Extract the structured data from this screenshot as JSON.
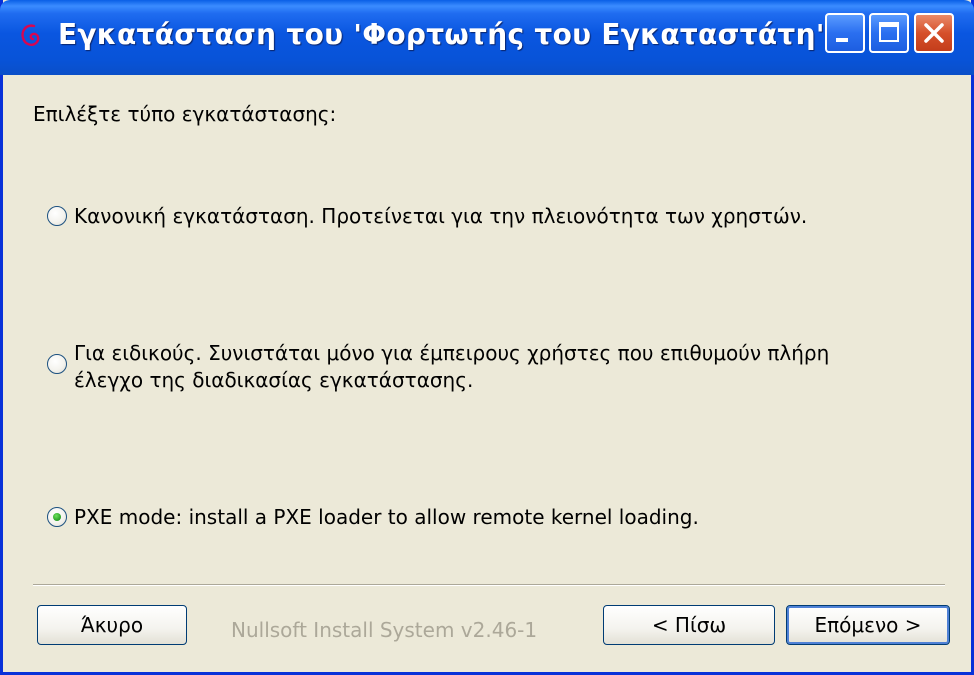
{
  "window": {
    "title": "Εγκατάσταση του 'Φορτωτής του Εγκαταστάτη'",
    "controls": [
      "minimize-icon",
      "maximize-icon",
      "close-icon"
    ],
    "accent_color": "#0a56e0",
    "close_color": "#d6502a"
  },
  "main": {
    "prompt": "Επιλέξτε τύπο εγκατάστασης:",
    "options": [
      {
        "label": "Κανονική εγκατάσταση. Προτείνεται για την πλειονότητα των χρηστών.",
        "checked": false
      },
      {
        "label_line1": "Για ειδικούς. Συνιστάται μόνο για έμπειρους χρήστες που επιθυμούν πλήρη",
        "label_line2": "έλεγχο της διαδικασίας εγκατάστασης.",
        "checked": false
      },
      {
        "label": "PXE mode: install a PXE loader to allow remote kernel loading.",
        "checked": true
      }
    ]
  },
  "footer": {
    "cancel_label": "Άκυρο",
    "branding": "Nullsoft Install System v2.46-1",
    "back_label": "< Πίσω",
    "next_label": "Επόμενο >"
  }
}
